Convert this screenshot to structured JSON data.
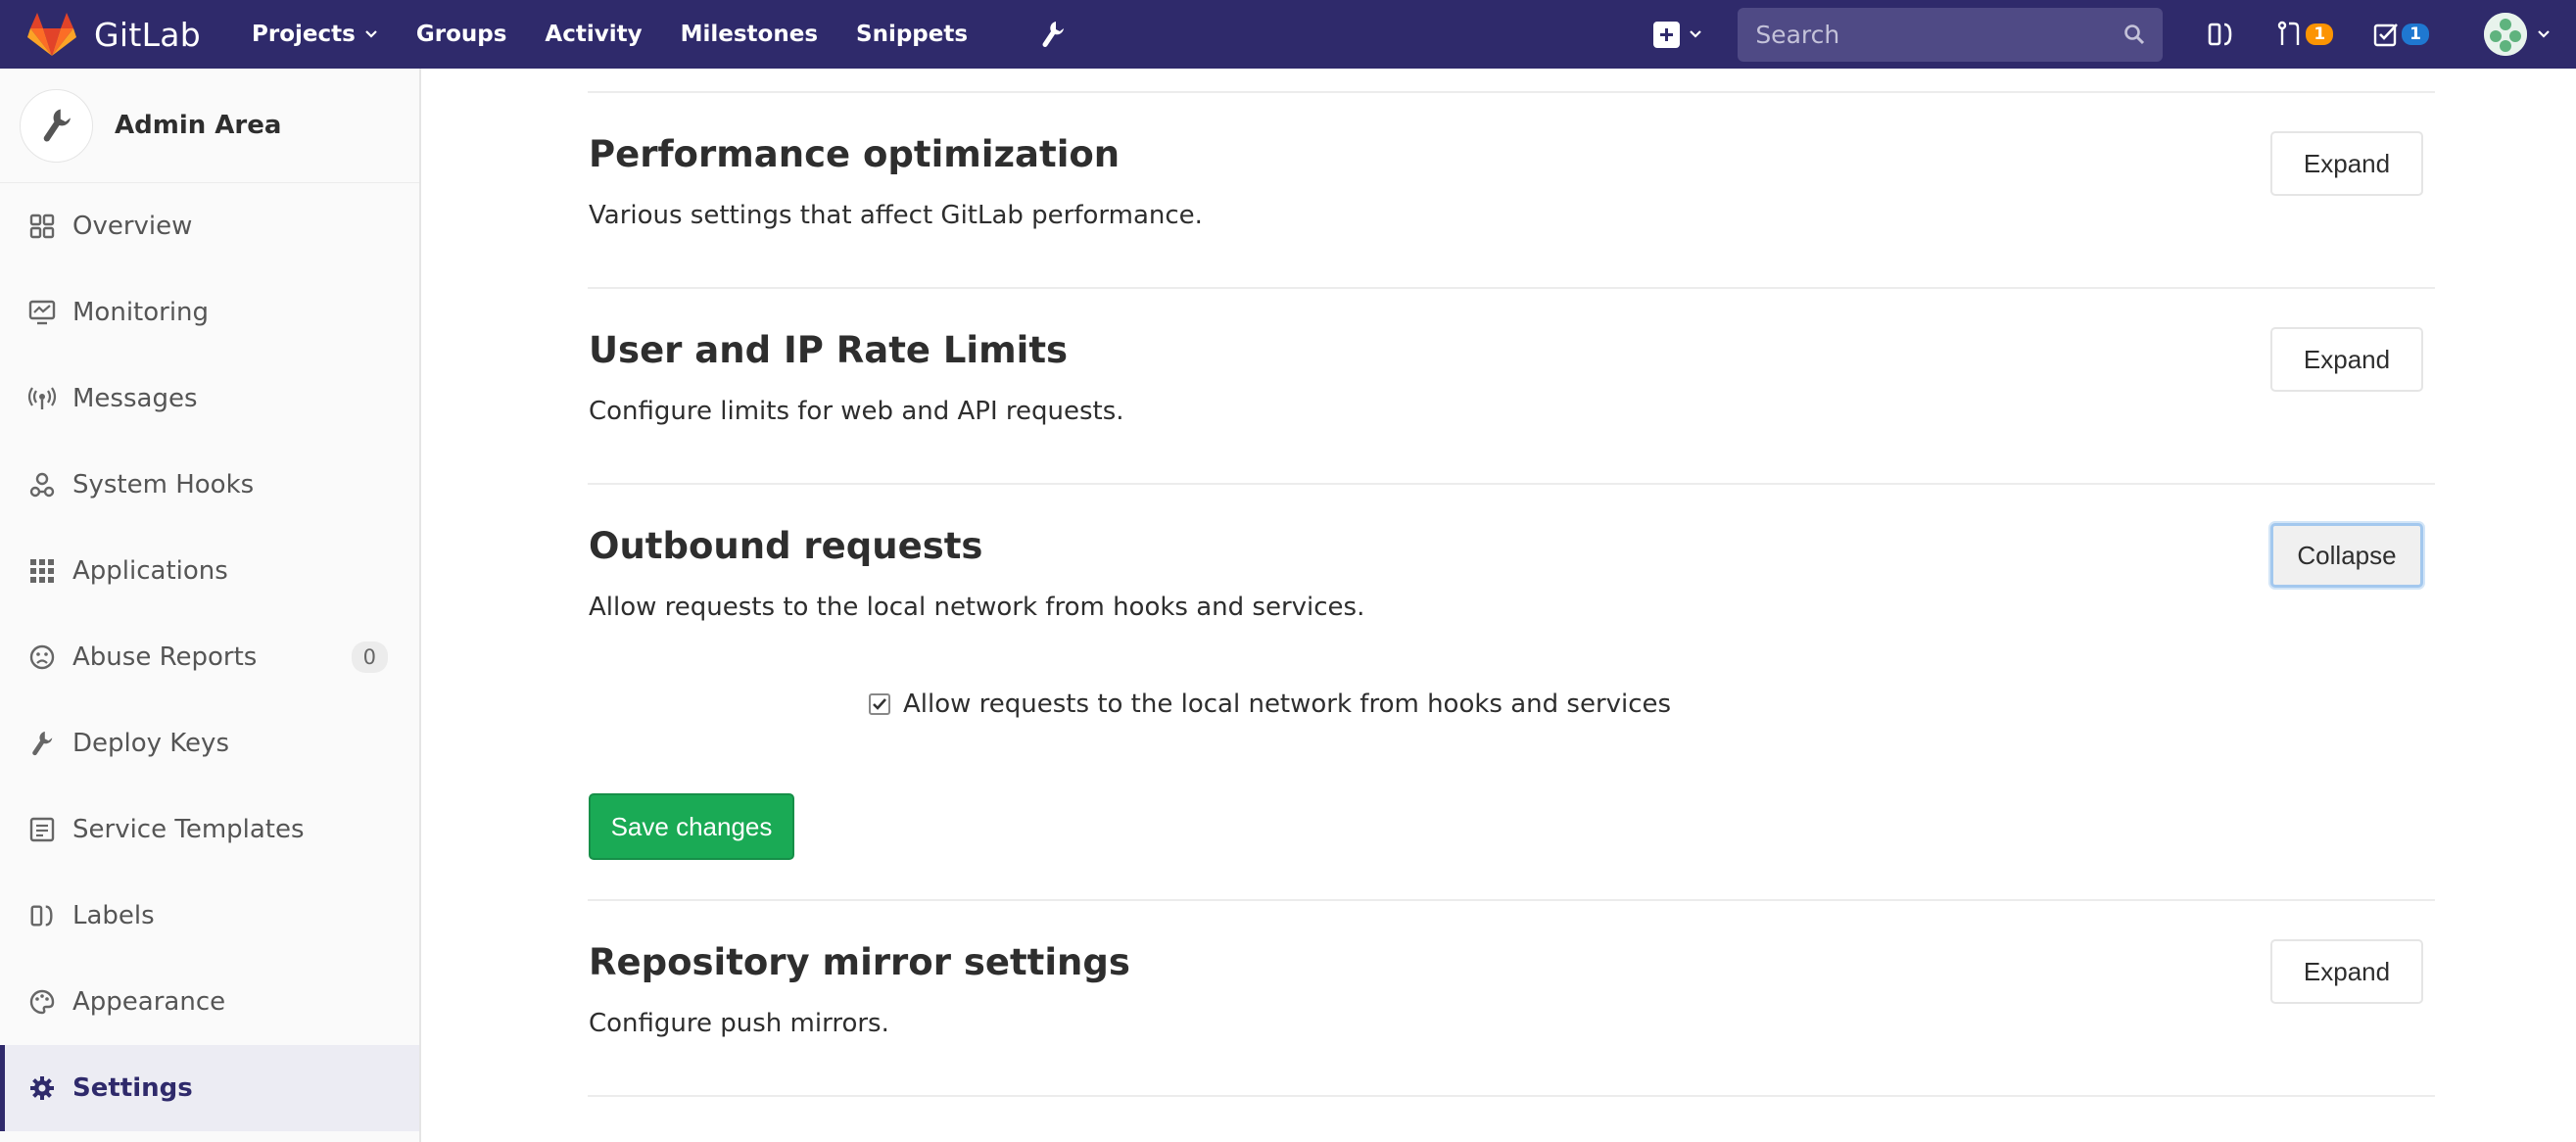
{
  "navbar": {
    "brand": "GitLab",
    "links": [
      "Projects",
      "Groups",
      "Activity",
      "Milestones",
      "Snippets"
    ],
    "search_placeholder": "Search",
    "merge_requests_count": "1",
    "todos_count": "1",
    "brand_color": "#2f2a6b"
  },
  "sidebar": {
    "title": "Admin Area",
    "items": [
      {
        "label": "Overview",
        "icon": "overview-icon"
      },
      {
        "label": "Monitoring",
        "icon": "monitoring-icon"
      },
      {
        "label": "Messages",
        "icon": "broadcast-icon"
      },
      {
        "label": "System Hooks",
        "icon": "hook-icon"
      },
      {
        "label": "Applications",
        "icon": "applications-icon"
      },
      {
        "label": "Abuse Reports",
        "icon": "abuse-icon",
        "count": "0"
      },
      {
        "label": "Deploy Keys",
        "icon": "key-icon"
      },
      {
        "label": "Service Templates",
        "icon": "template-icon"
      },
      {
        "label": "Labels",
        "icon": "labels-icon"
      },
      {
        "label": "Appearance",
        "icon": "palette-icon"
      },
      {
        "label": "Settings",
        "icon": "gear-icon",
        "active": true
      }
    ]
  },
  "sections": [
    {
      "title": "Performance optimization",
      "description": "Various settings that affect GitLab performance.",
      "button": "Expand"
    },
    {
      "title": "User and IP Rate Limits",
      "description": "Configure limits for web and API requests.",
      "button": "Expand"
    },
    {
      "title": "Outbound requests",
      "description": "Allow requests to the local network from hooks and services.",
      "button": "Collapse"
    },
    {
      "title": "Repository mirror settings",
      "description": "Configure push mirrors.",
      "button": "Expand"
    }
  ],
  "outbound": {
    "checkbox_label": "Allow requests to the local network from hooks and services",
    "checked": true,
    "save_label": "Save changes"
  }
}
